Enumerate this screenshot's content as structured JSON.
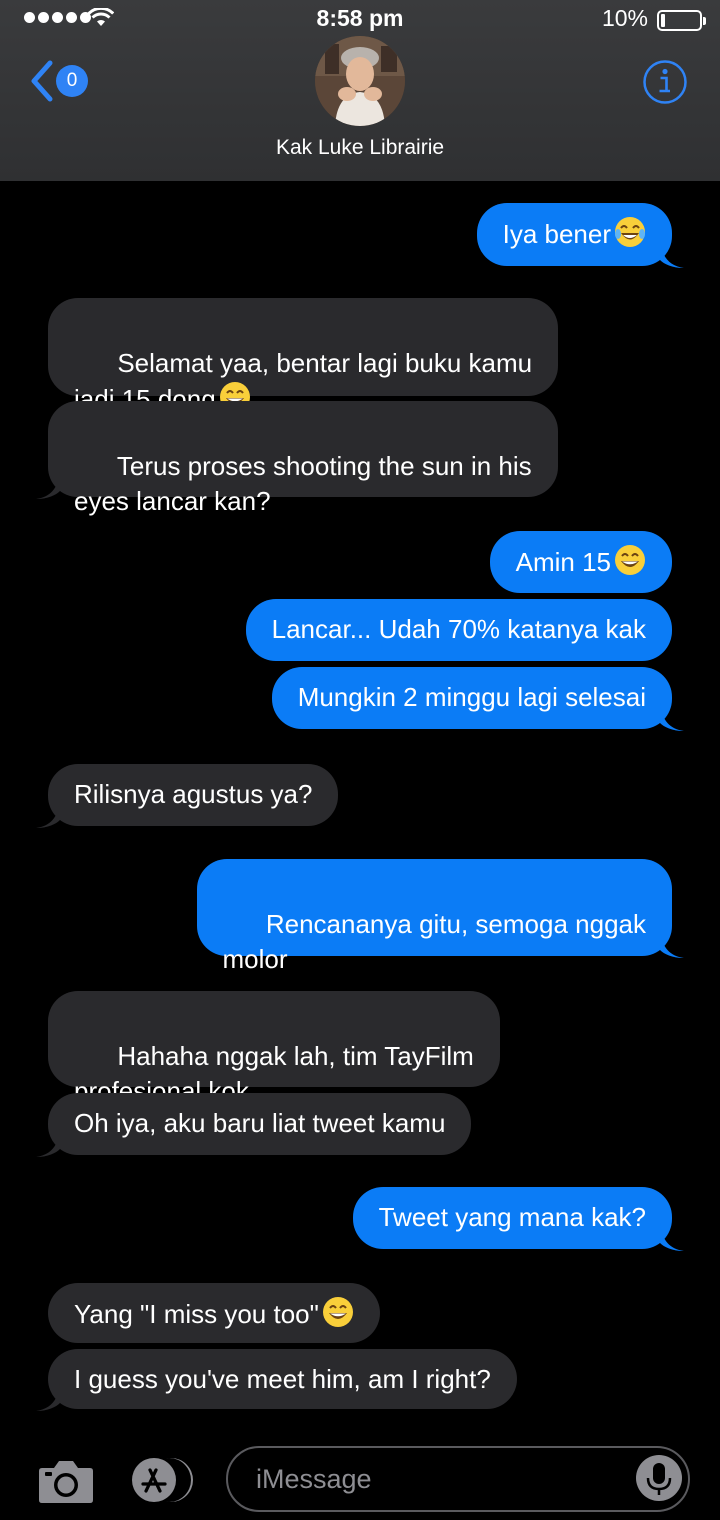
{
  "status_bar": {
    "time": "8:58 pm",
    "battery": "10%"
  },
  "header": {
    "back_count": "0",
    "contact_name": "Kak Luke Librairie"
  },
  "messages": [
    {
      "side": "out",
      "text": "Iya bener",
      "emoji": "laughing-tears-emoji"
    },
    {
      "side": "in",
      "text": "Selamat yaa, bentar lagi buku kamu\njadi 15 dong",
      "emoji": "grinning-emoji"
    },
    {
      "side": "in",
      "text": "Terus proses shooting the sun in his\neyes lancar kan?"
    },
    {
      "side": "out",
      "text": "Amin 15",
      "emoji": "grinning-emoji"
    },
    {
      "side": "out",
      "text": "Lancar... Udah 70% katanya kak"
    },
    {
      "side": "out",
      "text": "Mungkin 2 minggu lagi selesai"
    },
    {
      "side": "in",
      "text": "Rilisnya agustus ya?"
    },
    {
      "side": "out",
      "text": "Rencananya gitu, semoga nggak\nmolor"
    },
    {
      "side": "in",
      "text": "Hahaha nggak lah, tim TayFilm\nprofesional kok"
    },
    {
      "side": "in",
      "text": "Oh iya, aku baru liat tweet kamu"
    },
    {
      "side": "out",
      "text": "Tweet yang mana kak?"
    },
    {
      "side": "in",
      "text": "Yang \"I miss you too\"",
      "emoji": "grinning-emoji"
    },
    {
      "side": "in",
      "text": "I guess you've meet him, am I right?"
    }
  ],
  "input": {
    "placeholder": "iMessage"
  },
  "colors": {
    "outgoing": "#0b7cf6",
    "incoming": "#2a2a2d",
    "accent": "#2f83f5"
  },
  "icons": [
    "back-chevron-icon",
    "info-icon",
    "camera-icon",
    "app-store-icon",
    "microphone-icon",
    "wifi-icon",
    "battery-icon"
  ]
}
